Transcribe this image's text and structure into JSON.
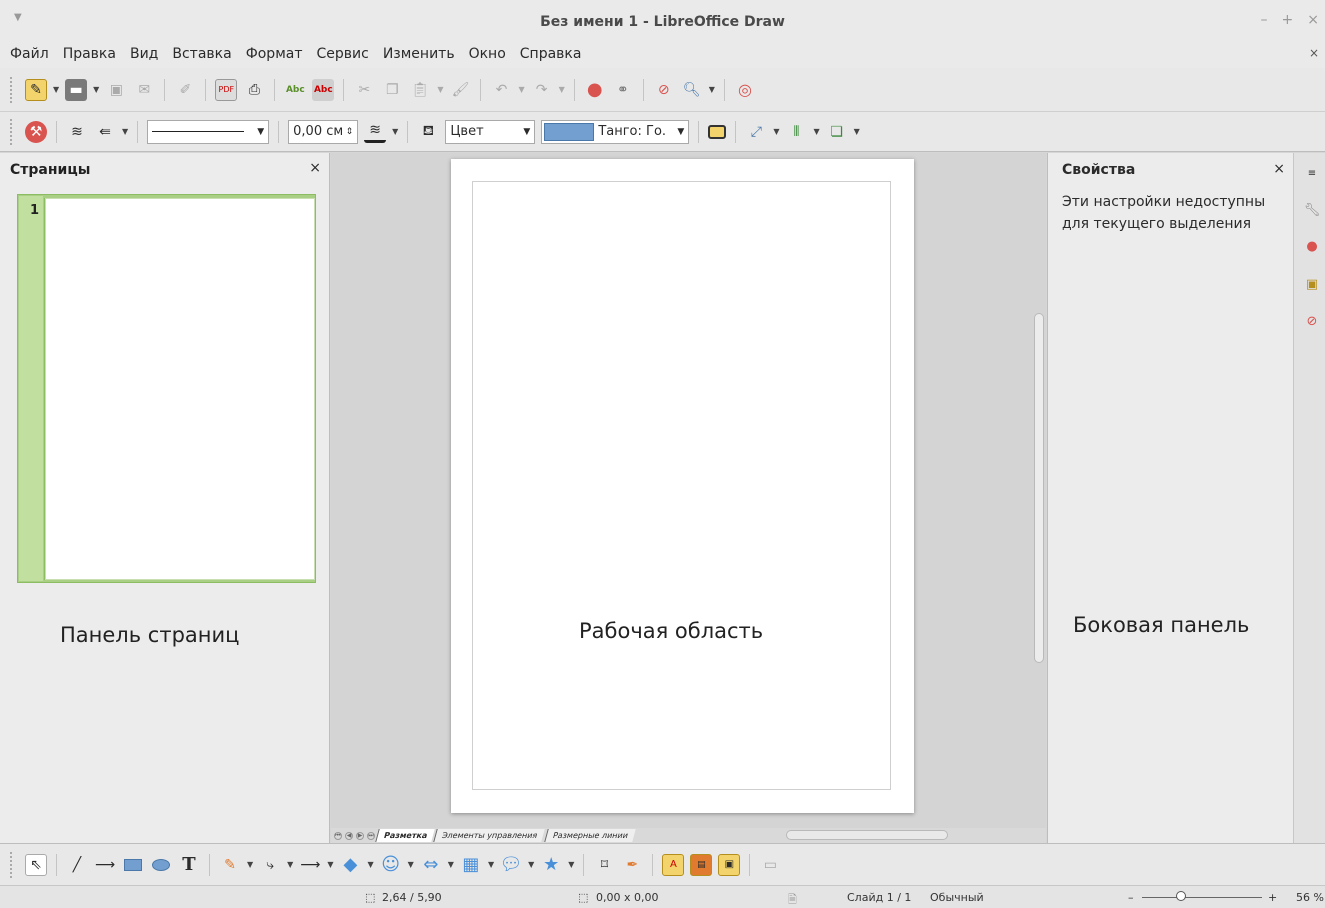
{
  "window": {
    "title": "Без имени 1 - LibreOffice Draw",
    "minimize": "–",
    "maximize": "+",
    "close": "×"
  },
  "menubar": {
    "items": [
      "Файл",
      "Правка",
      "Вид",
      "Вставка",
      "Формат",
      "Сервис",
      "Изменить",
      "Окно",
      "Справка"
    ],
    "close": "×"
  },
  "toolbar2": {
    "line_width": "0,00 см",
    "area_style": "Цвет",
    "fill_color": "Танго: Го.",
    "fill_swatch_color": "#729fcf"
  },
  "pages_panel": {
    "header": "Страницы",
    "close": "×",
    "page_number": "1",
    "caption": "Панель страниц"
  },
  "workspace": {
    "caption": "Рабочая область"
  },
  "layer_tabs": [
    "Разметка",
    "Элементы управления",
    "Размерные линии"
  ],
  "sidebar": {
    "header": "Свойства",
    "close": "×",
    "message": "Эти настройки недоступны для текущего выделения",
    "caption": "Боковая панель"
  },
  "statusbar": {
    "position": "2,64 / 5,90",
    "size": "0,00 x 0,00",
    "slide": "Слайд 1 / 1",
    "layout": "Обычный",
    "zoom": "56 %"
  },
  "colors": {
    "pages_highlight": "#a9cf85",
    "accent_red": "#d9534f"
  }
}
